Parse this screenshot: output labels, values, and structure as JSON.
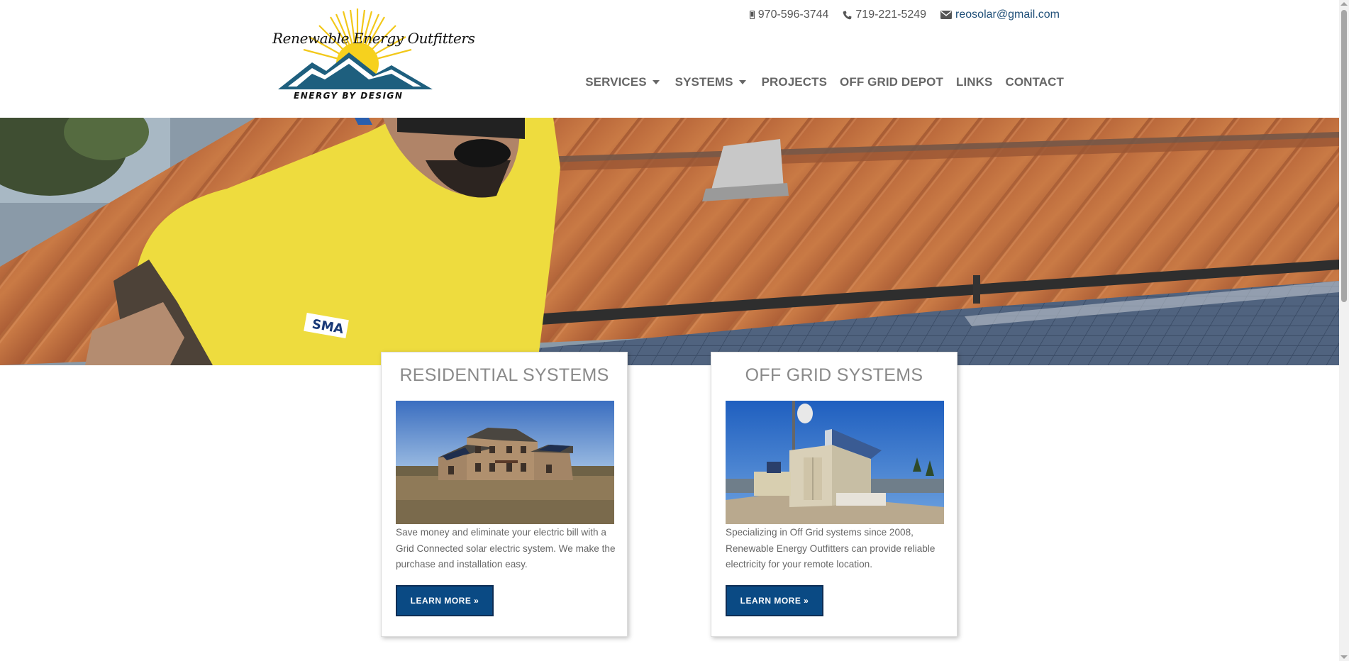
{
  "brand": {
    "logo_text": "Renewable Energy Outfitters",
    "tagline": "ENERGY BY DESIGN"
  },
  "contact": {
    "phone1": "970-596-3744",
    "phone2": "719-221-5249",
    "email": "reosolar@gmail.com"
  },
  "nav": {
    "items": [
      {
        "label": "SERVICES",
        "dropdown": true
      },
      {
        "label": "SYSTEMS",
        "dropdown": true
      },
      {
        "label": "PROJECTS",
        "dropdown": false
      },
      {
        "label": "OFF GRID DEPOT",
        "dropdown": false
      },
      {
        "label": "LINKS",
        "dropdown": false
      },
      {
        "label": "CONTACT",
        "dropdown": false
      }
    ]
  },
  "hero": {
    "icon": "rooftop-solar-installer-photo"
  },
  "cards": [
    {
      "title": "RESIDENTIAL SYSTEMS",
      "text": "Save money and eliminate your electric bill with a Grid Connected solar electric system. We make the purchase and installation easy.",
      "button": "LEARN MORE »",
      "image_icon": "residential-house-photo"
    },
    {
      "title": "OFF GRID SYSTEMS",
      "text": "Specializing in Off Grid systems since 2008, Renewable Energy Outfitters can provide reliable electricity for your remote location.",
      "button": "LEARN MORE »",
      "image_icon": "off-grid-shed-photo"
    }
  ],
  "colors": {
    "button_bg": "#0a4a84",
    "email_link": "#1f4f78",
    "nav_text": "#666666",
    "card_title": "#8a8a8a"
  }
}
